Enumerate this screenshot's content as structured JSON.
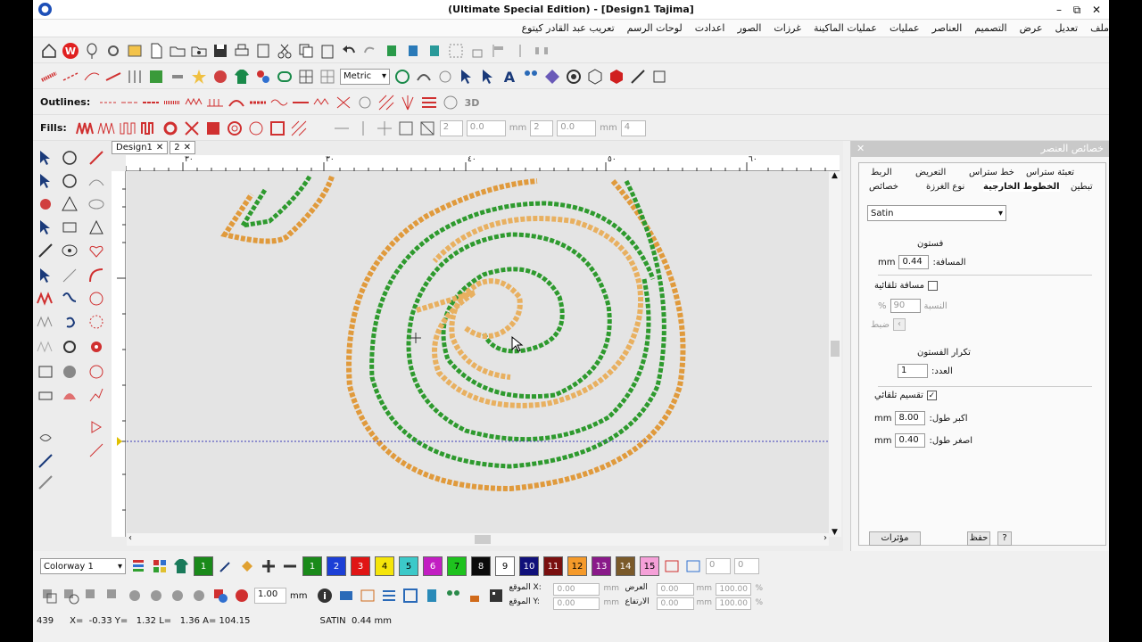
{
  "window": {
    "title": "(Ultimate Special Edition) - [Design1      Tajima]",
    "minimize": "–",
    "maximize": "⧉",
    "close": "✕"
  },
  "menu": [
    "ملف",
    "تعديل",
    "عرض",
    "التصميم",
    "العناصر",
    "عمليات",
    "عمليات الماكينة",
    "غرزات",
    "الصور",
    "اعدادت",
    "لوحات الرسم",
    "تعريب عبد القادر كيتوع"
  ],
  "toolbar_outlines": {
    "label": "Outlines:"
  },
  "toolbar_fills": {
    "label": "Fills:",
    "spin1": "2",
    "spin2": "0.0",
    "spin2_unit": "mm",
    "spin3": "2",
    "spin4": "0.0",
    "spin4_unit": "mm",
    "spin5": "4"
  },
  "toolbar_main": {
    "units": "Metric"
  },
  "tabs": [
    {
      "label": "Design1"
    },
    {
      "label": "2"
    }
  ],
  "ruler": {
    "ticks": [
      "٣٠",
      "٣٠",
      "٤٠",
      "٥٠",
      "٦٠"
    ]
  },
  "panel": {
    "title": "خصائص العنصر",
    "tabs_row1": [
      "تعبئة ستراس",
      "خط ستراس",
      "التعريض",
      "الربط"
    ],
    "tabs_row2": [
      "تبطين",
      "الخطوط الخارجية",
      "نوع الغرزة",
      "خصائص"
    ],
    "stitch_type": "Satin",
    "section_fastoon": "فستون",
    "distance_label": "المسافة:",
    "distance_value": "0.44",
    "distance_unit": "mm",
    "auto_spacing_label": "مسافة تلقائية",
    "ratio_label": "النسبة",
    "ratio_value": "90",
    "ratio_unit": "%",
    "adjust_label": "ضبط",
    "repeat_section": "تكرار الفستون",
    "count_label": "العدد:",
    "count_value": "1",
    "auto_split_label": "تقسيم تلقائي",
    "max_len_label": "اكبر طول:",
    "max_len_value": "8.00",
    "max_len_unit": "mm",
    "min_len_label": "اصغر طول:",
    "min_len_value": "0.40",
    "min_len_unit": "mm",
    "effects_button": "مؤثرات",
    "save_button": "حفظ",
    "help_button": "?"
  },
  "colorbar": {
    "colorway": "Colorway 1",
    "current": "1",
    "swatches": [
      {
        "num": "1",
        "color": "#1a8a1a"
      },
      {
        "num": "2",
        "color": "#1c3fd6"
      },
      {
        "num": "3",
        "color": "#e01515"
      },
      {
        "num": "4",
        "color": "#f5e50a"
      },
      {
        "num": "5",
        "color": "#3cc9c9"
      },
      {
        "num": "6",
        "color": "#c21ec2"
      },
      {
        "num": "7",
        "color": "#1ec21e"
      },
      {
        "num": "8",
        "color": "#0b0b0b"
      },
      {
        "num": "9",
        "color": "#ffffff"
      },
      {
        "num": "10",
        "color": "#10107a"
      },
      {
        "num": "11",
        "color": "#7a1010"
      },
      {
        "num": "12",
        "color": "#f59a2a"
      },
      {
        "num": "13",
        "color": "#8a1a8a"
      },
      {
        "num": "14",
        "color": "#7a5a2a"
      },
      {
        "num": "15",
        "color": "#f5a0d8"
      }
    ],
    "spin_a": "0",
    "spin_b": "0"
  },
  "bottom": {
    "scale_value": "1.00",
    "scale_unit": "mm",
    "pos_x_label": "الموقع X:",
    "pos_x_value": "0.00",
    "pos_y_label": "الموقع Y:",
    "pos_y_value": "0.00",
    "width_label": "العرض",
    "width_value": "0.00",
    "height_label": "الارتفاع",
    "height_value": "0.00",
    "unit": "mm",
    "pct_w": "100.00",
    "pct_h": "100.00",
    "pct": "%"
  },
  "status": {
    "count": "439",
    "coords": "X=  -0.33 Y=   1.32 L=   1.36 A= 104.15",
    "stitch": "SATIN  0.44 mm"
  }
}
